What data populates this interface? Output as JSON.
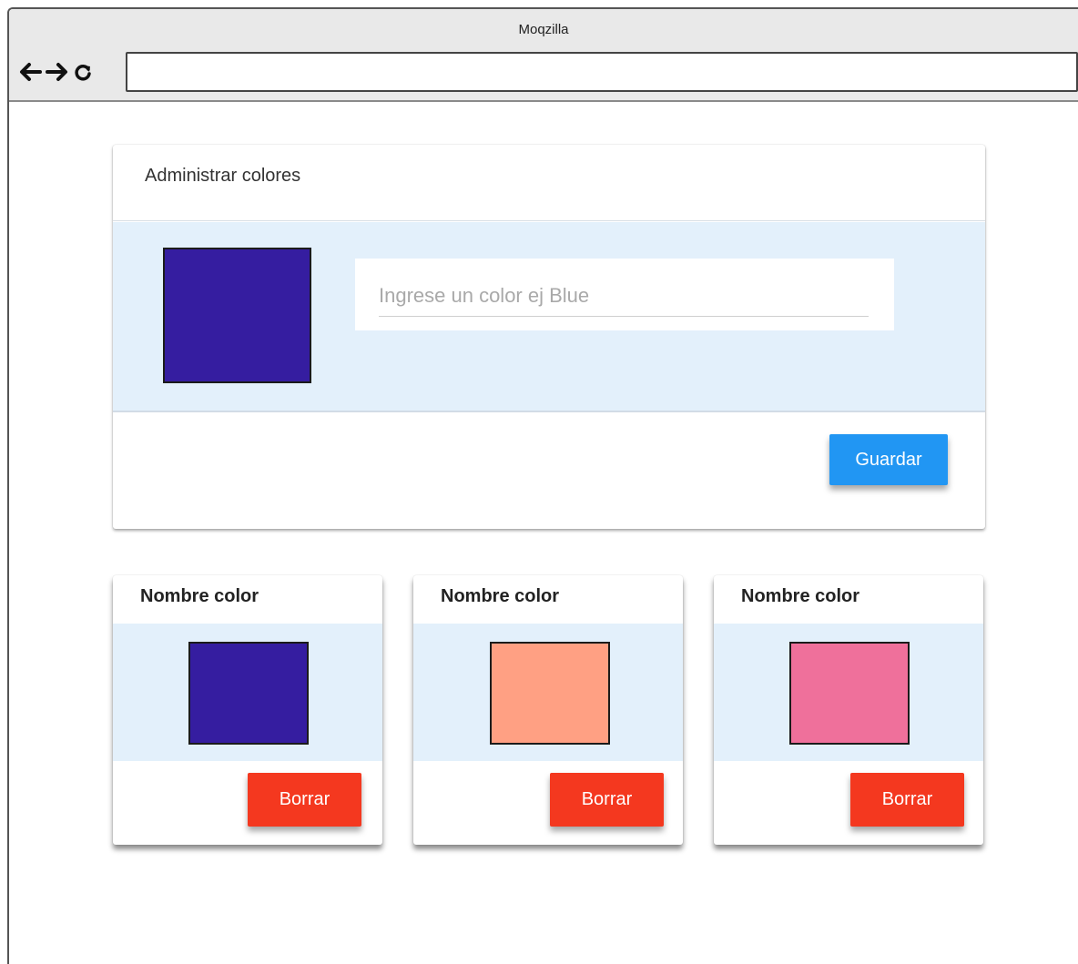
{
  "browser": {
    "title": "Moqzilla",
    "address_value": ""
  },
  "manager": {
    "heading": "Administrar colores",
    "preview_color": "#351da0",
    "input_placeholder": "Ingrese un color ej Blue",
    "input_value": "",
    "save_label": "Guardar",
    "save_color": "#2196f3"
  },
  "colors": [
    {
      "name": "Nombre color",
      "swatch": "#351da0",
      "delete_label": "Borrar"
    },
    {
      "name": "Nombre color",
      "swatch": "#ffa083",
      "delete_label": "Borrar"
    },
    {
      "name": "Nombre color",
      "swatch": "#ef709b",
      "delete_label": "Borrar"
    }
  ],
  "theme": {
    "panel_bg": "#e3f0fb",
    "delete_color": "#f4381f"
  }
}
